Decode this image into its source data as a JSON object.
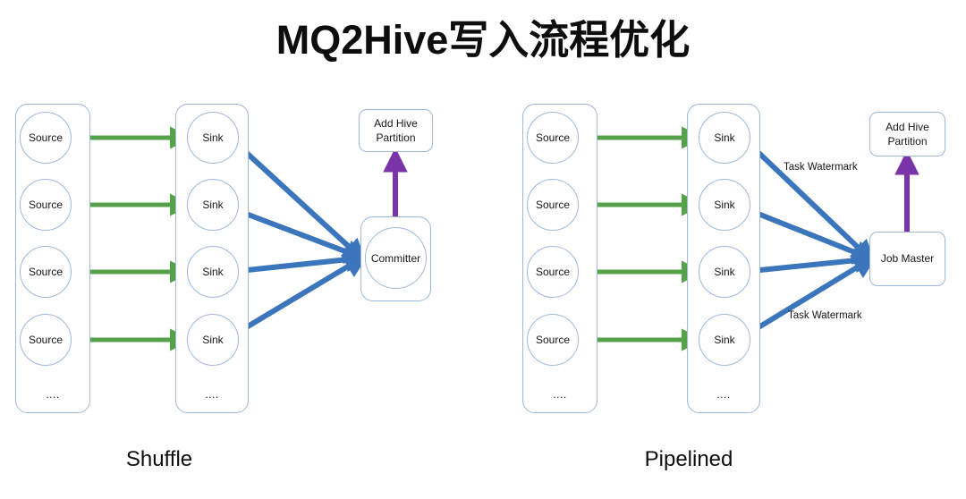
{
  "title": "MQ2Hive写入流程优化",
  "colors": {
    "background": "#ffffff",
    "title_text": "#0d0d0d",
    "node_border": "#9DB7DE",
    "green_arrow": "#56A24A",
    "blue_arrow": "#3B75BC",
    "purple_arrow": "#7B33A8",
    "body_text": "#171717"
  },
  "diagrams": [
    {
      "id": "shuffle",
      "caption": "Shuffle",
      "source_group": {
        "ellipsis": "....",
        "nodes": [
          {
            "label": "Source"
          },
          {
            "label": "Source"
          },
          {
            "label": "Source"
          },
          {
            "label": "Source"
          }
        ]
      },
      "sink_group": {
        "ellipsis": "....",
        "nodes": [
          {
            "label": "Sink"
          },
          {
            "label": "Sink"
          },
          {
            "label": "Sink"
          },
          {
            "label": "Sink"
          }
        ]
      },
      "aggregator": {
        "label": "Committer",
        "shape": "circle-in-box"
      },
      "output": {
        "label": "Add Hive\nPartition",
        "line1": "Add Hive",
        "line2": "Partition"
      },
      "edge_labels": []
    },
    {
      "id": "pipelined",
      "caption": "Pipelined",
      "source_group": {
        "ellipsis": "....",
        "nodes": [
          {
            "label": "Source"
          },
          {
            "label": "Source"
          },
          {
            "label": "Source"
          },
          {
            "label": "Source"
          }
        ]
      },
      "sink_group": {
        "ellipsis": "....",
        "nodes": [
          {
            "label": "Sink"
          },
          {
            "label": "Sink"
          },
          {
            "label": "Sink"
          },
          {
            "label": "Sink"
          }
        ]
      },
      "aggregator": {
        "label": "Job Master",
        "shape": "box"
      },
      "output": {
        "label": "Add Hive\nPartition",
        "line1": "Add Hive",
        "line2": "Partition"
      },
      "edge_labels": [
        {
          "label": "Task Watermark"
        },
        {
          "label": "Task Watermark"
        }
      ]
    }
  ]
}
